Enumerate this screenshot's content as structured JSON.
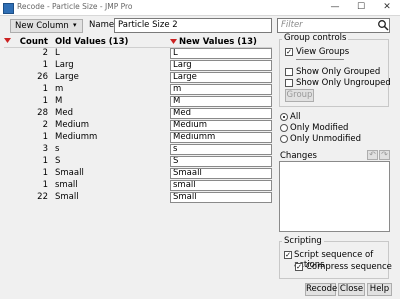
{
  "window": {
    "title": "Recode - Particle Size - JMP Pro",
    "minimize": "—",
    "maximize": "☐",
    "close": "✕"
  },
  "toolbar": {
    "new_column_label": "New Column",
    "name_label": "Name:",
    "name_value": "Particle Size 2",
    "filter_placeholder": "Filter"
  },
  "table": {
    "headers": {
      "count": "Count",
      "old": "Old Values (13)",
      "new": "New Values (13)"
    },
    "rows": [
      {
        "count": "2",
        "old": "L",
        "new": "L"
      },
      {
        "count": "1",
        "old": "Larg",
        "new": "Larg"
      },
      {
        "count": "26",
        "old": "Large",
        "new": "Large"
      },
      {
        "count": "1",
        "old": "m",
        "new": "m"
      },
      {
        "count": "1",
        "old": "M",
        "new": "M"
      },
      {
        "count": "28",
        "old": "Med",
        "new": "Med"
      },
      {
        "count": "2",
        "old": "Medium",
        "new": "Medium"
      },
      {
        "count": "1",
        "old": "Mediumm",
        "new": "Mediumm"
      },
      {
        "count": "3",
        "old": "s",
        "new": "s"
      },
      {
        "count": "1",
        "old": "S",
        "new": "S"
      },
      {
        "count": "1",
        "old": "Smaall",
        "new": "Smaall"
      },
      {
        "count": "1",
        "old": "small",
        "new": "small"
      },
      {
        "count": "22",
        "old": "Small",
        "new": "Small"
      }
    ]
  },
  "group_controls": {
    "legend": "Group controls",
    "view_groups": {
      "label": "View Groups",
      "checked": true
    },
    "show_only_grouped": {
      "label": "Show Only Grouped",
      "checked": false
    },
    "show_only_ungrouped": {
      "label": "Show Only Ungrouped",
      "checked": false
    },
    "group_button": "Group"
  },
  "show_options": [
    {
      "label": "All",
      "selected": true
    },
    {
      "label": "Only Modified",
      "selected": false
    },
    {
      "label": "Only Unmodified",
      "selected": false
    }
  ],
  "changes": {
    "label": "Changes",
    "undo": "↶",
    "redo": "↷"
  },
  "scripting": {
    "legend": "Scripting",
    "script_sequence": {
      "label": "Script sequence of actions",
      "checked": true
    },
    "compress_sequence": {
      "label": "Compress sequence",
      "checked": true
    }
  },
  "buttons": {
    "recode": "Recode",
    "close": "Close",
    "help": "Help"
  },
  "icons": {
    "search": "search-icon",
    "dropdown": "chevron-down-icon",
    "red_triangle": "red-triangle-menu-icon"
  },
  "colors": {
    "red_triangle": "#cc2222",
    "title_icon": "#2f6fb5"
  }
}
